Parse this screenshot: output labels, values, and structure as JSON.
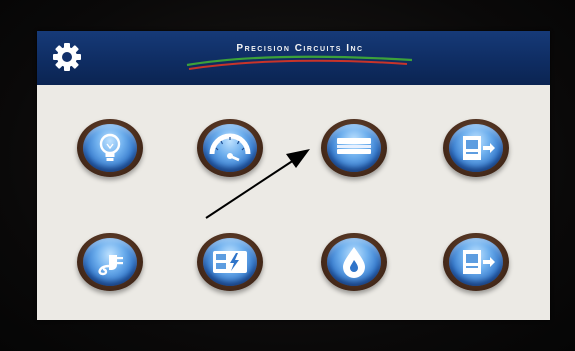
{
  "app": {
    "brand": "Precision Circuits Inc"
  },
  "header": {
    "settings_icon": "gear-icon"
  },
  "tiles": [
    {
      "id": "lighting",
      "icon": "lightbulb-icon"
    },
    {
      "id": "gauge",
      "icon": "gauge-icon"
    },
    {
      "id": "layers",
      "icon": "layers-icon"
    },
    {
      "id": "machine-out",
      "icon": "machine-output-icon"
    },
    {
      "id": "power",
      "icon": "power-plug-icon"
    },
    {
      "id": "electrical",
      "icon": "electrical-panel-icon"
    },
    {
      "id": "heat",
      "icon": "flame-droplet-icon"
    },
    {
      "id": "machine-out-2",
      "icon": "machine-output-icon"
    }
  ],
  "colors": {
    "header_bg": "#0f2d63",
    "screen_bg": "#eceae5",
    "tile_rim": "#4d2f1e",
    "tile_face": "#2f74c9",
    "swoosh_green": "#3ca13a",
    "swoosh_red": "#c8342a"
  }
}
